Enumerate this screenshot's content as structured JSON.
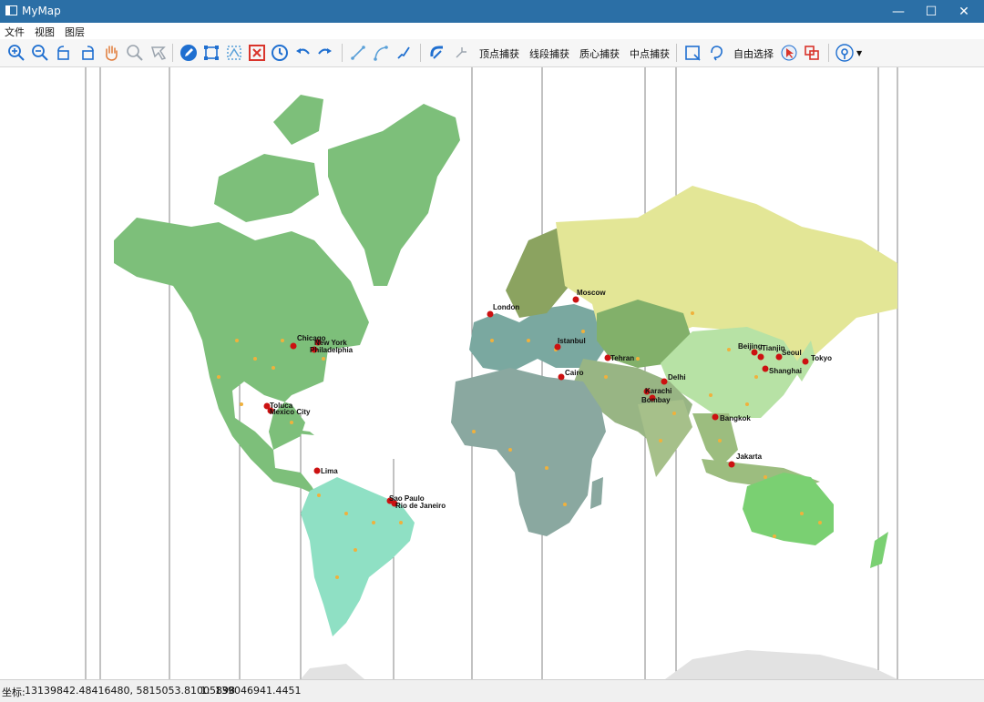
{
  "window": {
    "title": "MyMap",
    "minimize": "—",
    "maximize": "☐",
    "close": "✕"
  },
  "menu": {
    "file": "文件",
    "view": "视图",
    "layer": "图层"
  },
  "toolbar": {
    "vertex_snap": "顶点捕获",
    "segment_snap": "线段捕获",
    "centroid_snap": "质心捕获",
    "midpoint_snap": "中点捕获",
    "free_select": "自由选择"
  },
  "colors": {
    "titlebar": "#2b6fa6",
    "icon_blue": "#1f6fd0",
    "icon_red": "#d9342b",
    "north_america": "#7dbf7a",
    "south_america": "#8fe0c4",
    "africa": "#8aa8a0",
    "europe": "#7aa8a0",
    "russia": "#e3e696",
    "china": "#b7e2a5",
    "australia": "#7ad072",
    "city_dot": "#cc1111",
    "point_dot": "#f0b13c"
  },
  "map": {
    "cities": [
      "Chicago",
      "New York",
      "Philadelphia",
      "Toluca",
      "Mexico City",
      "Lima",
      "Sao Paulo",
      "Rio de Janeiro",
      "London",
      "Moscow",
      "Istanbul",
      "Cairo",
      "Tehran",
      "Karachi",
      "Delhi",
      "Bombay",
      "Beijing",
      "Tianjin",
      "Seoul",
      "Tokyo",
      "Shanghai",
      "Bangkok",
      "Jakarta"
    ]
  },
  "status": {
    "coordinate_label": "坐标:",
    "coordinates": "13139842.48416480, 5815053.81005898",
    "scale_label": "1:",
    "scale": "139046941.4451"
  }
}
